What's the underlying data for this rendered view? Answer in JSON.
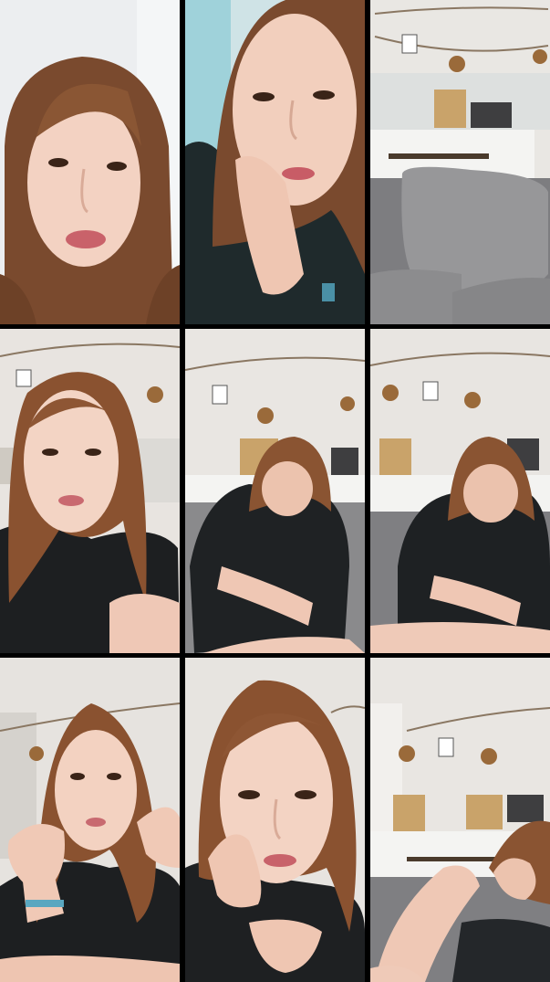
{
  "collage": {
    "rows": 3,
    "columns": 3,
    "tiles": [
      {
        "scene": "close-up-white-wall"
      },
      {
        "scene": "close-up-chin-on-hand"
      },
      {
        "scene": "room-sofa-cushion"
      },
      {
        "scene": "portrait-room-background"
      },
      {
        "scene": "seated-looking-down"
      },
      {
        "scene": "seated-looking-down-closer"
      },
      {
        "scene": "hands-gesture"
      },
      {
        "scene": "close-up-hand-cheek"
      },
      {
        "scene": "seated-knee-up"
      }
    ]
  },
  "colors": {
    "gutter": "#000000",
    "hair": "#7a4a2e",
    "skin": "#f3d2c2",
    "clothing": "#1e2224",
    "wall": "#ece9e6",
    "sofa": "#8a8a8c"
  }
}
